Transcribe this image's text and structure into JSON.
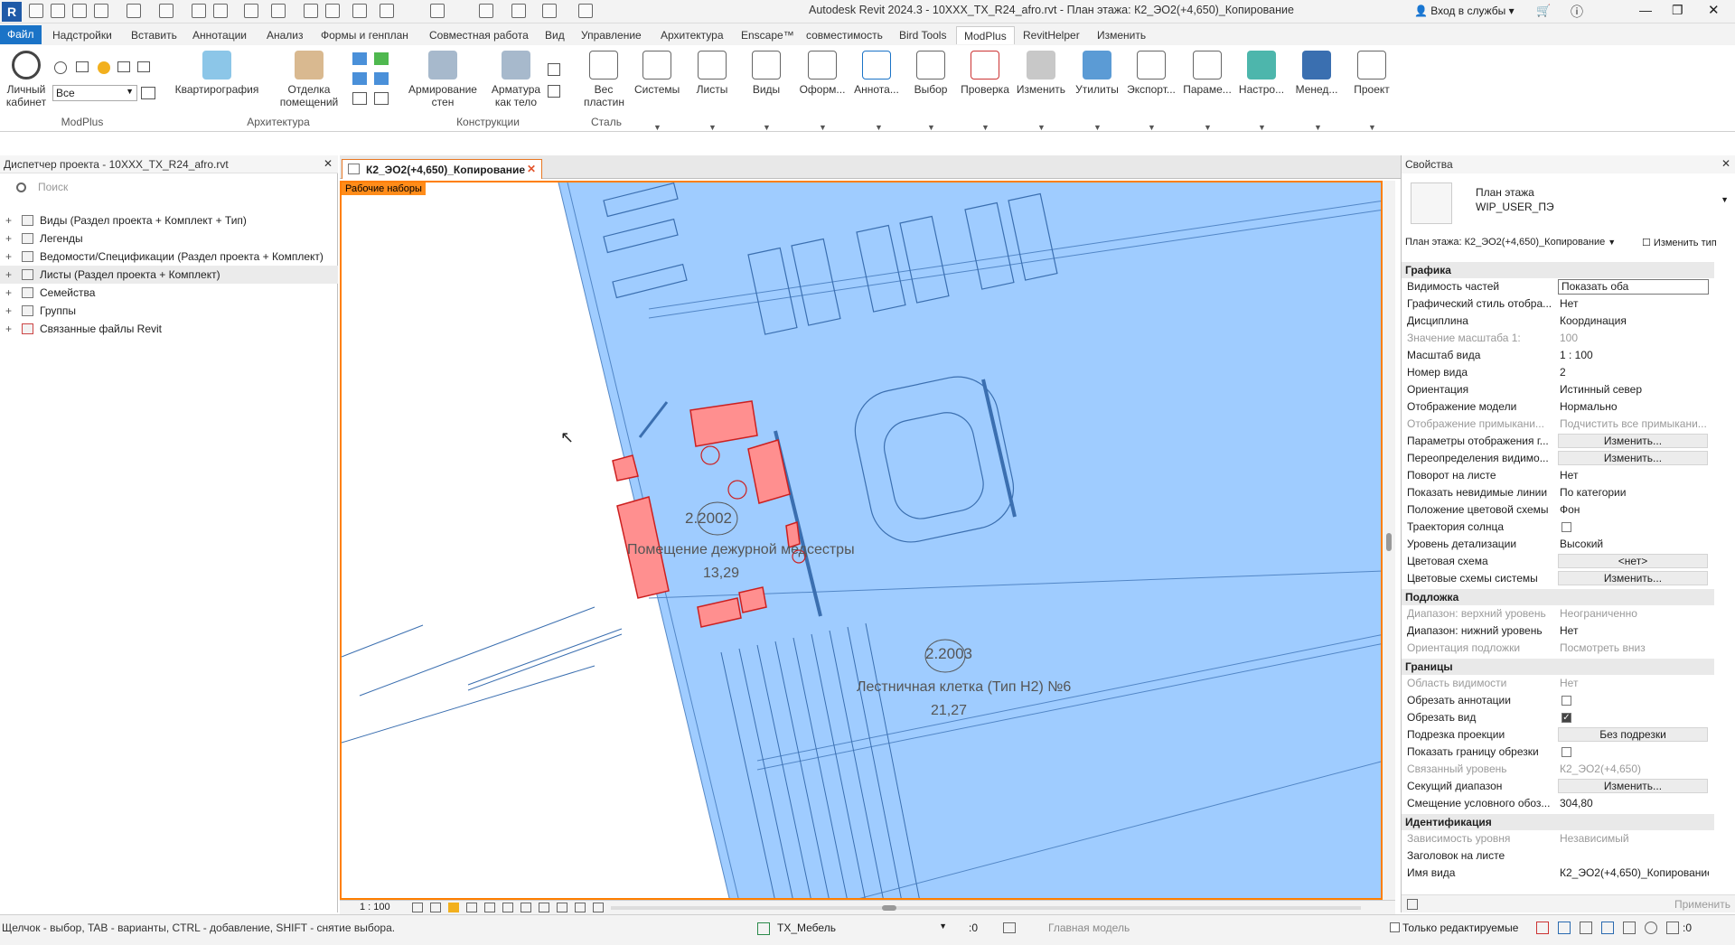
{
  "titlebar": {
    "logo": "R",
    "title": "Autodesk Revit 2024.3 - 10XXX_TX_R24_afro.rvt - План этажа: К2_ЭО2(+4,650)_Копирование",
    "signin": "Вход в службы"
  },
  "tabs": [
    "Файл",
    "Надстройки",
    "Вставить",
    "Аннотации",
    "Анализ",
    "Формы и генплан",
    "Совместная работа",
    "Вид",
    "Управление",
    "Архитектура",
    "Enscape™",
    "совместимость",
    "Bird Tools",
    "ModPlus",
    "RevitHelper",
    "Изменить"
  ],
  "ribbon": {
    "personal": "Личный кабинет",
    "filter_value": "Все",
    "buttons": [
      "Квартирография",
      "Отделка помещений",
      "Армирование стен",
      "Арматура как тело",
      "Вес пластин",
      "Системы",
      "Листы",
      "Виды",
      "Оформ...",
      "Аннота...",
      "Выбор",
      "Проверка",
      "Изменить",
      "Утилиты",
      "Экспорт...",
      "Параме...",
      "Настро...",
      "Менед...",
      "Проект"
    ],
    "panels": [
      "ModPlus",
      "Архитектура",
      "Конструкции",
      "Сталь"
    ]
  },
  "browser": {
    "title": "Диспетчер проекта - 10XXX_TX_R24_afro.rvt",
    "search_placeholder": "Поиск",
    "items": [
      "Виды (Раздел проекта + Комплект + Тип)",
      "Легенды",
      "Ведомости/Спецификации (Раздел проекта + Комплект)",
      "Листы (Раздел проекта + Комплект)",
      "Семейства",
      "Группы",
      "Связанные файлы Revit"
    ]
  },
  "view": {
    "tab": "К2_ЭО2(+4,650)_Копирование",
    "worksets": "Рабочие наборы",
    "rooms": [
      {
        "num": "2.2002",
        "name": "Помещение дежурной медсестры",
        "area": "13,29"
      },
      {
        "num": "2.2003",
        "name": "Лестничная клетка (Тип Н2) №6",
        "area": "21,27"
      }
    ],
    "scale": "1 : 100"
  },
  "props": {
    "title": "Свойства",
    "type_line1": "План этажа",
    "type_line2": "WIP_USER_ПЭ",
    "selector": "План этажа: К2_ЭО2(+4,650)_Копирование",
    "edit_type": "Изменить тип",
    "sections": {
      "graphics": "Графика",
      "underlay": "Подложка",
      "extents": "Границы",
      "ident": "Идентификация"
    },
    "rows": [
      {
        "k": "Видимость частей",
        "v": "Показать оба"
      },
      {
        "k": "Графический стиль отобра...",
        "v": "Нет"
      },
      {
        "k": "Дисциплина",
        "v": "Координация"
      },
      {
        "k": "Значение масштаба    1:",
        "v": "100"
      },
      {
        "k": "Масштаб вида",
        "v": "1 : 100"
      },
      {
        "k": "Номер вида",
        "v": "2"
      },
      {
        "k": "Ориентация",
        "v": "Истинный север"
      },
      {
        "k": "Отображение модели",
        "v": "Нормально"
      },
      {
        "k": "Отображение примыкани...",
        "v": "Подчистить все примыкани..."
      },
      {
        "k": "Параметры отображения г...",
        "v": "Изменить..."
      },
      {
        "k": "Переопределения видимо...",
        "v": "Изменить..."
      },
      {
        "k": "Поворот на листе",
        "v": "Нет"
      },
      {
        "k": "Показать невидимые линии",
        "v": "По категории"
      },
      {
        "k": "Положение цветовой схемы",
        "v": "Фон"
      },
      {
        "k": "Траектория солнца",
        "v": ""
      },
      {
        "k": "Уровень детализации",
        "v": "Высокий"
      },
      {
        "k": "Цветовая схема",
        "v": "<нет>"
      },
      {
        "k": "Цветовые схемы системы",
        "v": "Изменить..."
      },
      {
        "k": "Диапазон: верхний уровень",
        "v": "Неограниченно"
      },
      {
        "k": "Диапазон: нижний уровень",
        "v": "Нет"
      },
      {
        "k": "Ориентация подложки",
        "v": "Посмотреть вниз"
      },
      {
        "k": "Область видимости",
        "v": "Нет"
      },
      {
        "k": "Обрезать аннотации",
        "v": ""
      },
      {
        "k": "Обрезать вид",
        "v": "✓"
      },
      {
        "k": "Подрезка проекции",
        "v": "Без подрезки"
      },
      {
        "k": "Показать границу обрезки",
        "v": ""
      },
      {
        "k": "Связанный уровень",
        "v": "К2_ЭО2(+4,650)"
      },
      {
        "k": "Секущий диапазон",
        "v": "Изменить..."
      },
      {
        "k": "Смещение условного обоз...",
        "v": "304,80"
      },
      {
        "k": "Зависимость уровня",
        "v": "Независимый"
      },
      {
        "k": "Заголовок на листе",
        "v": ""
      },
      {
        "k": "Имя вида",
        "v": "К2_ЭО2(+4,650)_Копирование"
      }
    ],
    "apply": "Применить"
  },
  "status": {
    "hint": "Щелчок - выбор, TAB - варианты, CTRL - добавление, SHIFT - снятие выбора.",
    "workset": "TX_Мебель",
    "zero1": ":0",
    "model": "Главная модель",
    "editable": "Только редактируемые",
    "zero2": ":0"
  }
}
